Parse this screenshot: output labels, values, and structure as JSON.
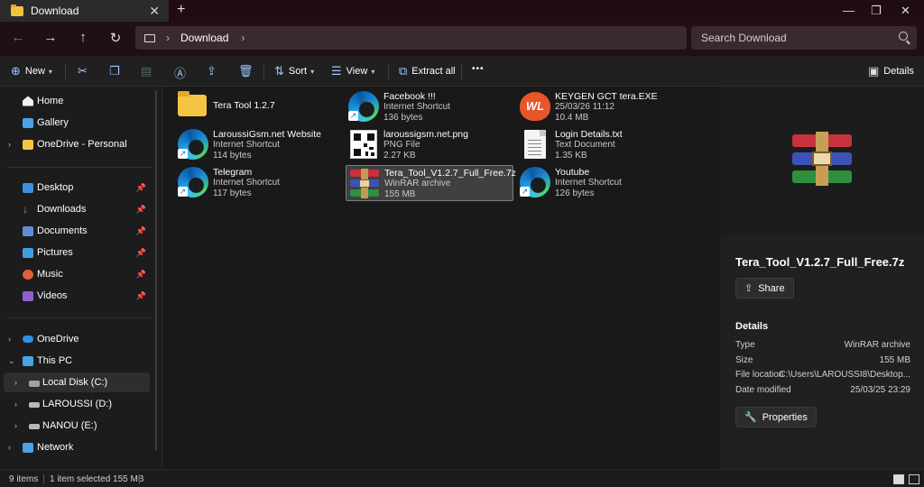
{
  "window": {
    "tab_title": "Download",
    "close_tab": "✕",
    "new_tab": "+",
    "minimize": "—",
    "maximize": "❐",
    "close": "✕"
  },
  "address": {
    "back": "←",
    "forward": "→",
    "up": "↑",
    "refresh": "↻",
    "breadcrumb": [
      "Download"
    ],
    "search_placeholder": "Search Download"
  },
  "toolbar": {
    "new_label": "New",
    "sort_label": "Sort",
    "view_label": "View",
    "extract_label": "Extract all",
    "more_label": "•••",
    "details_label": "Details"
  },
  "sidebar": {
    "items": [
      {
        "label": "Home",
        "icon": "home-icon"
      },
      {
        "label": "Gallery",
        "icon": "gallery-icon"
      },
      {
        "label": "OneDrive - Personal",
        "icon": "folder-icon"
      },
      {
        "label": "Desktop",
        "icon": "desktop-icon"
      },
      {
        "label": "Downloads",
        "icon": "download-icon"
      },
      {
        "label": "Documents",
        "icon": "document-icon"
      },
      {
        "label": "Pictures",
        "icon": "pictures-icon"
      },
      {
        "label": "Music",
        "icon": "music-icon"
      },
      {
        "label": "Videos",
        "icon": "videos-icon"
      },
      {
        "label": "OneDrive",
        "icon": "cloud-icon"
      },
      {
        "label": "This PC",
        "icon": "pc-icon"
      },
      {
        "label": "Local Disk (C:)",
        "icon": "drive-icon"
      },
      {
        "label": "LAROUSSI (D:)",
        "icon": "drive-icon"
      },
      {
        "label": "NANOU (E:)",
        "icon": "drive-icon"
      },
      {
        "label": "Network",
        "icon": "network-icon"
      }
    ]
  },
  "files": [
    {
      "name": "Tera Tool 1.2.7",
      "type": "",
      "size": "",
      "icon": "folder-icon"
    },
    {
      "name": "Facebook !!!",
      "type": "Internet Shortcut",
      "size": "136 bytes",
      "icon": "edge-icon"
    },
    {
      "name": "KEYGEN GCT tera.EXE",
      "type": "25/03/26 11:12",
      "size": "10.4 MB",
      "icon": "wl-app-icon"
    },
    {
      "name": "LaroussiGsm.net Website",
      "type": "Internet Shortcut",
      "size": "114 bytes",
      "icon": "edge-icon"
    },
    {
      "name": "laroussigsm.net.png",
      "type": "PNG File",
      "size": "2.27 KB",
      "icon": "qr-image-icon"
    },
    {
      "name": "Login Details.txt",
      "type": "Text Document",
      "size": "1.35 KB",
      "icon": "text-file-icon"
    },
    {
      "name": "Telegram",
      "type": "Internet Shortcut",
      "size": "117 bytes",
      "icon": "edge-icon"
    },
    {
      "name": "Tera_Tool_V1.2.7_Full_Free.7z",
      "type": "WinRAR archive",
      "size": "155 MB",
      "icon": "winrar-icon"
    },
    {
      "name": "Youtube",
      "type": "Internet Shortcut",
      "size": "126 bytes",
      "icon": "edge-icon"
    }
  ],
  "details": {
    "title": "Tera_Tool_V1.2.7_Full_Free.7z",
    "share_label": "Share",
    "section_label": "Details",
    "rows": [
      {
        "key": "Type",
        "value": "WinRAR archive"
      },
      {
        "key": "Size",
        "value": "155 MB"
      },
      {
        "key": "File location",
        "value": "C:\\Users\\LAROUSSI8\\Desktop..."
      },
      {
        "key": "Date modified",
        "value": "25/03/25 23:29"
      }
    ],
    "properties_label": "Properties"
  },
  "status": {
    "items_count": "9 items",
    "selection": "1 item selected  155 MB"
  },
  "colors": {
    "accent": "#9fc7ff",
    "folder": "#f6c443",
    "selection": "#404040"
  }
}
